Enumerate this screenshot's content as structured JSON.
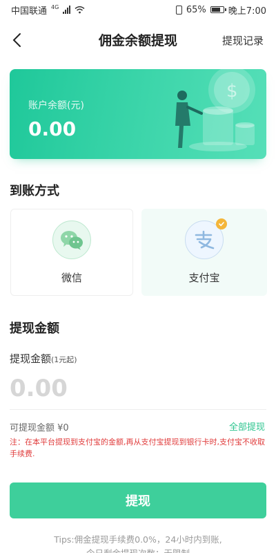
{
  "status_bar": {
    "carrier": "中国联通",
    "network": "4G",
    "battery": "65%",
    "time": "晚上7:00"
  },
  "nav": {
    "title": "佣金余额提现",
    "right_link": "提现记录"
  },
  "balance_card": {
    "label": "账户余额(元)",
    "amount": "0.00"
  },
  "payment_section": {
    "title": "到账方式",
    "options": [
      {
        "label": "微信",
        "selected": false,
        "icon": "wechat-icon"
      },
      {
        "label": "支付宝",
        "selected": true,
        "icon": "alipay-icon"
      }
    ]
  },
  "amount_section": {
    "title": "提现金额",
    "field_label": "提现金额",
    "field_hint": "(1元起)",
    "placeholder": "0.00",
    "available": "可提现金额 ¥0",
    "withdraw_all": "全部提现",
    "note": "注：在本平台提现到支付宝的金额,再从支付宝提现到银行卡时,支付宝不收取手续费."
  },
  "submit_label": "提现",
  "tips": {
    "line1": "Tips:佣金提现手续费0.0%，24小时内到账,",
    "line2": "今日剩余提现次数：无限制"
  },
  "colors": {
    "accent": "#3ecf9b",
    "card_start": "#1fc89a",
    "card_end": "#56dfb8",
    "warning": "#e03c3c"
  }
}
